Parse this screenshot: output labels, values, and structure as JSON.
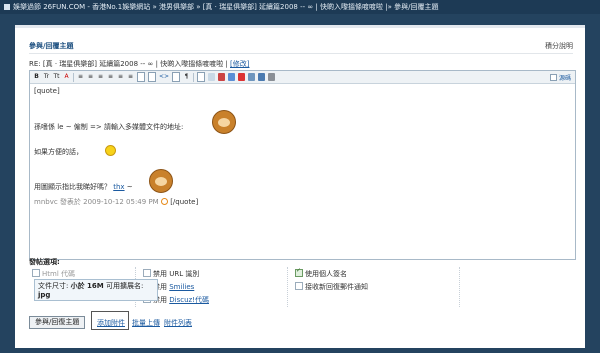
{
  "breadcrumb": {
    "text": "娛樂過節 26FUN.COM - 香港No.1娛樂網站 » 港男俱樂部 » [真 ‧ 瑞星俱樂部] 延續篇2008 -- ∞ | 快啲入嚟搵條喥喥啦 |» 參與/回覆主題"
  },
  "header": {
    "title": "參與/回覆主題",
    "right_link": "積分說明"
  },
  "subject": {
    "text": "RE: [真 ‧ 瑞星俱樂部] 延續篇2008 -- ∞ | 快啲入嚟搵條喥喥啦 | ",
    "edit_link": "[修改]"
  },
  "toolbar": {
    "buttons": [
      "B",
      "Tr",
      "Tt",
      "A",
      "A",
      "≡",
      "≡",
      "≡",
      "≡",
      "≡",
      "≡",
      "☷",
      "☷",
      "<>",
      "≡",
      "¶",
      "img",
      "Flash",
      "You",
      "Tube",
      "ilk",
      "fx"
    ],
    "mode_label": "源碼"
  },
  "editor": {
    "line1": "[quote]",
    "line2_text": "孫嗜係 le ~ 僱制 => 請輸入多媒體文件的地址:",
    "line2_link": "le",
    "line3": "如果方便的話，",
    "line4_text": "用圖顯示指比我睇好嗎？",
    "line4_link": "thx",
    "line4_tail": "~",
    "line5_meta": "mnbvc 發表於 2009-10-12 05:49 PM",
    "line5_tail": "[/quote]"
  },
  "options": {
    "title": "發帖選項:",
    "html_code": "Html 代碼",
    "disable_url": "禁用 URL 識別",
    "use_sign": "使用個人簽名",
    "disable_smilies_prefix": "禁用",
    "smilies": "Smilies",
    "notify": "接收新回復郵件通知",
    "disable_discuz_prefix": "禁用",
    "discuz": "Discuz!代碼"
  },
  "tooltip": {
    "line1_label": "文件尺寸:",
    "line1_value": "小於 16M",
    "line1_ext": "可用擴展名:",
    "line2": "jpg"
  },
  "actions": {
    "submit": "參與/回復主題",
    "add_attachment": "添加附件",
    "batch_upload": "批量上傳",
    "attachment_list": "附件列表"
  }
}
